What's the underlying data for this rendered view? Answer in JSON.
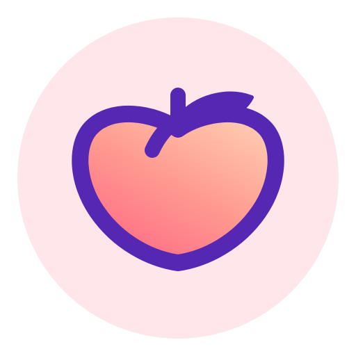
{
  "app_icon": {
    "icon_name": "peach-icon",
    "colors": {
      "background": "#ffffff",
      "badge_circle": "#fee6ea",
      "outline": "#5527b3",
      "fruit_gradient_light": "#ffc9b0",
      "fruit_gradient_mid": "#ff9a8f",
      "fruit_gradient_dark": "#ff6b86"
    }
  }
}
